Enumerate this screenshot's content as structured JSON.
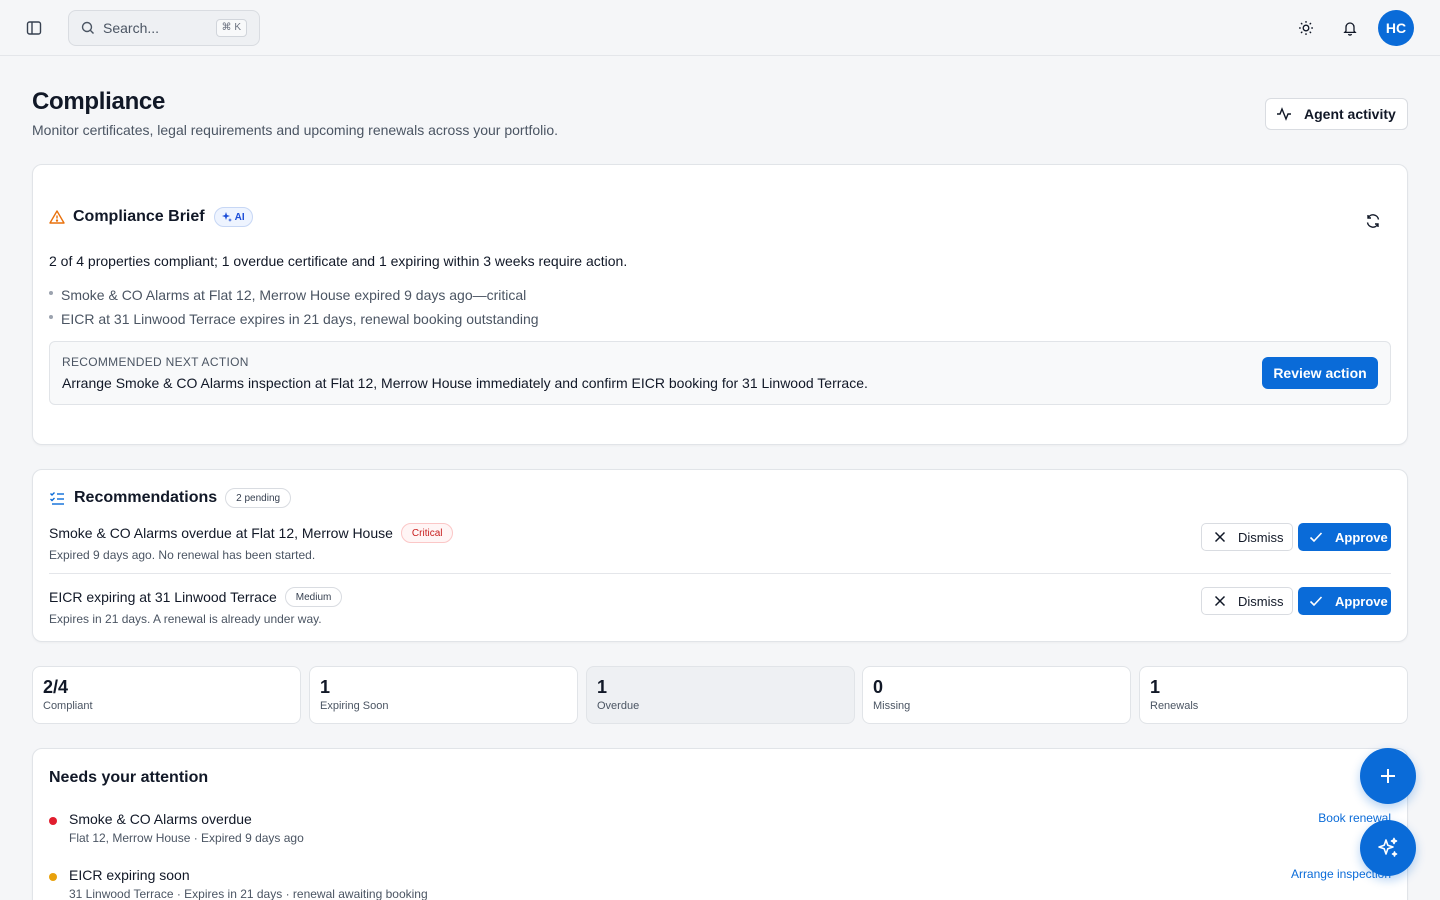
{
  "topbar": {
    "search_placeholder": "Search...",
    "search_shortcut": "⌘ K",
    "avatar_initials": "HC"
  },
  "header": {
    "title": "Compliance",
    "subtitle": "Monitor certificates, legal requirements and upcoming renewals across your portfolio.",
    "agent_activity_label": "Agent activity"
  },
  "brief": {
    "title": "Compliance Brief",
    "ai_badge": "AI",
    "summary": "2 of 4 properties compliant; 1 overdue certificate and 1 expiring within 3 weeks require action.",
    "points": [
      "Smoke & CO Alarms at Flat 12, Merrow House expired 9 days ago—critical",
      "EICR at 31 Linwood Terrace expires in 21 days, renewal booking outstanding"
    ],
    "next_action_label": "RECOMMENDED NEXT ACTION",
    "next_action_text": "Arrange Smoke & CO Alarms inspection at Flat 12, Merrow House immediately and confirm EICR booking for 31 Linwood Terrace.",
    "review_label": "Review action"
  },
  "recommendations": {
    "title": "Recommendations",
    "pending_badge": "2 pending",
    "items": [
      {
        "title": "Smoke & CO Alarms overdue at Flat 12, Merrow House",
        "severity": "Critical",
        "detail": "Expired 9 days ago. No renewal has been started.",
        "dismiss": "Dismiss",
        "approve": "Approve"
      },
      {
        "title": "EICR expiring at 31 Linwood Terrace",
        "severity": "Medium",
        "detail": "Expires in 21 days. A renewal is already under way.",
        "dismiss": "Dismiss",
        "approve": "Approve"
      }
    ]
  },
  "stats": [
    {
      "value": "2/4",
      "label": "Compliant"
    },
    {
      "value": "1",
      "label": "Expiring Soon"
    },
    {
      "value": "1",
      "label": "Overdue"
    },
    {
      "value": "0",
      "label": "Missing"
    },
    {
      "value": "1",
      "label": "Renewals"
    }
  ],
  "attention": {
    "title": "Needs your attention",
    "items": [
      {
        "title": "Smoke & CO Alarms overdue",
        "detail": "Flat 12, Merrow House · Expired 9 days ago",
        "action": "Book renewal",
        "color": "#e11d2e"
      },
      {
        "title": "EICR expiring soon",
        "detail": "31 Linwood Terrace · Expires in 21 days · renewal awaiting booking",
        "action": "Arrange inspection",
        "color": "#e8a10c"
      }
    ]
  },
  "colors": {
    "accent": "#0a6bd8",
    "warning_icon": "#e8710c",
    "critical": "#c81e1e"
  }
}
